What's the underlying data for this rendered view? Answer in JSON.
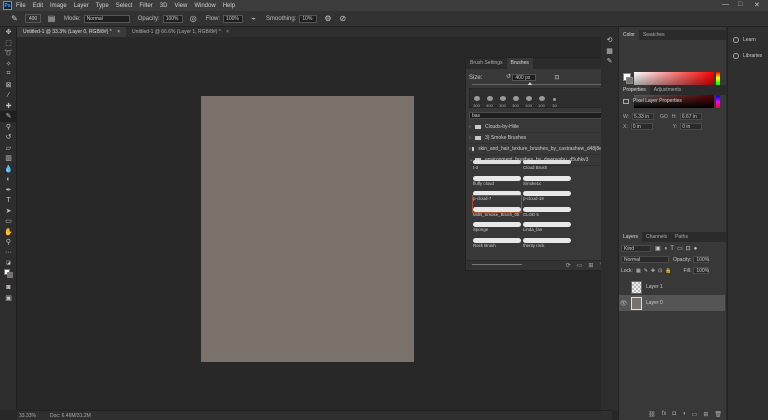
{
  "menu": [
    "File",
    "Edit",
    "Image",
    "Layer",
    "Type",
    "Select",
    "Filter",
    "3D",
    "View",
    "Window",
    "Help"
  ],
  "window_controls": [
    "—",
    "□",
    "✕"
  ],
  "options": {
    "mode_label": "Mode:",
    "mode_value": "Normal",
    "opacity_label": "Opacity:",
    "opacity_value": "100%",
    "flow_label": "Flow:",
    "flow_value": "100%",
    "smoothing_label": "Smoothing:",
    "smoothing_value": "10%",
    "brush_size": "400"
  },
  "tabs": [
    {
      "label": "Untitled-1 @ 33.3% (Layer 0, RGB/8#) *"
    },
    {
      "label": "Untitled-1 @ 66.6% (Layer 1, RGB/8#) *"
    }
  ],
  "status": {
    "zoom": "33.33%",
    "doc": "Doc: 6.46M/31.2M"
  },
  "brush_panel": {
    "tab_settings": "Brush Settings",
    "tab_brushes": "Brushes",
    "size_label": "Size:",
    "size_value": "400 px",
    "presets": [
      "300",
      "400",
      "300",
      "300",
      "100",
      "100",
      "30"
    ],
    "search_value": "bas",
    "folders": [
      "Clouds-by-Hiile",
      "3) Smoke Brushes",
      "skin_and_hair_texture_brushes_by_castrashew_d48j8el",
      "environment_brushes_by_dawnyabu_d5uhkv3"
    ],
    "brushes": [
      "t-3",
      "Cloud Brush",
      "fluffy cloud",
      "Smoke1c",
      "p-cloud-7",
      "p-cloud-19",
      "MdB_Smoke_Brush_05",
      "CLOD 5",
      "Sponge",
      "Linda_fan",
      "Rock Brush",
      "thenty rock"
    ]
  },
  "color_panel": {
    "tab_color": "Color",
    "tab_swatches": "Swatches"
  },
  "properties_panel": {
    "tab_properties": "Properties",
    "tab_adjustments": "Adjustments",
    "title": "Pixel Layer Properties",
    "w_label": "W:",
    "w_value": "5.33 in",
    "go_label": "GO",
    "h_label": "H:",
    "h_value": "6.67 in",
    "x_label": "X:",
    "x_value": "0 in",
    "y_label": "Y:",
    "y_value": "0 in"
  },
  "layers_panel": {
    "tab_layers": "Layers",
    "tab_channels": "Channels",
    "tab_paths": "Paths",
    "filter_value": "Kind",
    "blend_mode": "Normal",
    "opacity_label": "Opacity:",
    "opacity_value": "100%",
    "lock_label": "Lock:",
    "fill_label": "Fill:",
    "fill_value": "100%",
    "layers": [
      "Layer 1",
      "Layer 0"
    ]
  },
  "dock": {
    "learn": "Learn",
    "libraries": "Libraries"
  }
}
